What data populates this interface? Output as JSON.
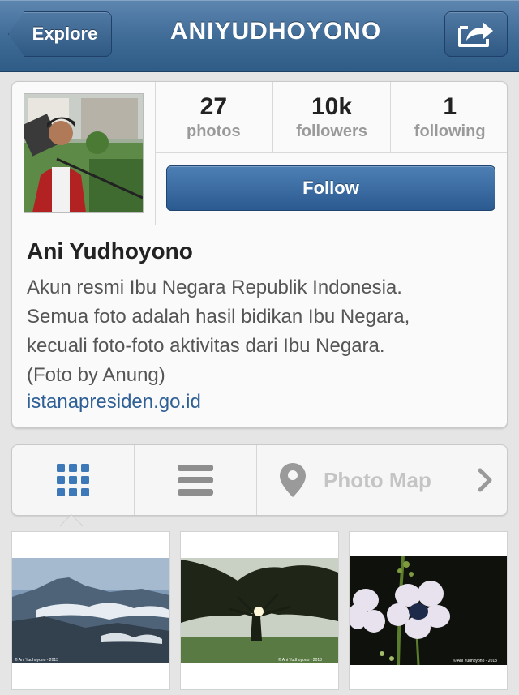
{
  "nav": {
    "back_label": "Explore",
    "title": "ANIYUDHOYONO",
    "share_icon": "share-icon"
  },
  "profile": {
    "stats": [
      {
        "value": "27",
        "label": "photos"
      },
      {
        "value": "10k",
        "label": "followers"
      },
      {
        "value": "1",
        "label": "following"
      }
    ],
    "follow_label": "Follow",
    "name": "Ani Yudhoyono",
    "bio": "Akun resmi Ibu Negara Republik Indonesia.\nSemua foto adalah hasil bidikan Ibu Negara,\nkecuali foto-foto aktivitas dari Ibu Negara.\n(Foto by Anung)",
    "link": "istanapresiden.go.id"
  },
  "tabs": {
    "grid_icon": "grid-view-icon",
    "list_icon": "list-view-icon",
    "map_icon": "location-pin-icon",
    "map_label": "Photo Map",
    "chevron_icon": "chevron-right-icon",
    "active": "grid"
  },
  "photos": [
    {
      "subject": "mountains",
      "watermark": "© Ani Yudhoyono - 2013"
    },
    {
      "subject": "tree",
      "watermark": "© Ani Yudhoyono - 2013"
    },
    {
      "subject": "flowers",
      "watermark": "© Ani Yudhoyono - 2013"
    }
  ],
  "colors": {
    "nav": "#3e6a96",
    "follow": "#2b5a90",
    "link": "#2e5f95",
    "active_tab_icon": "#3d78b8"
  }
}
